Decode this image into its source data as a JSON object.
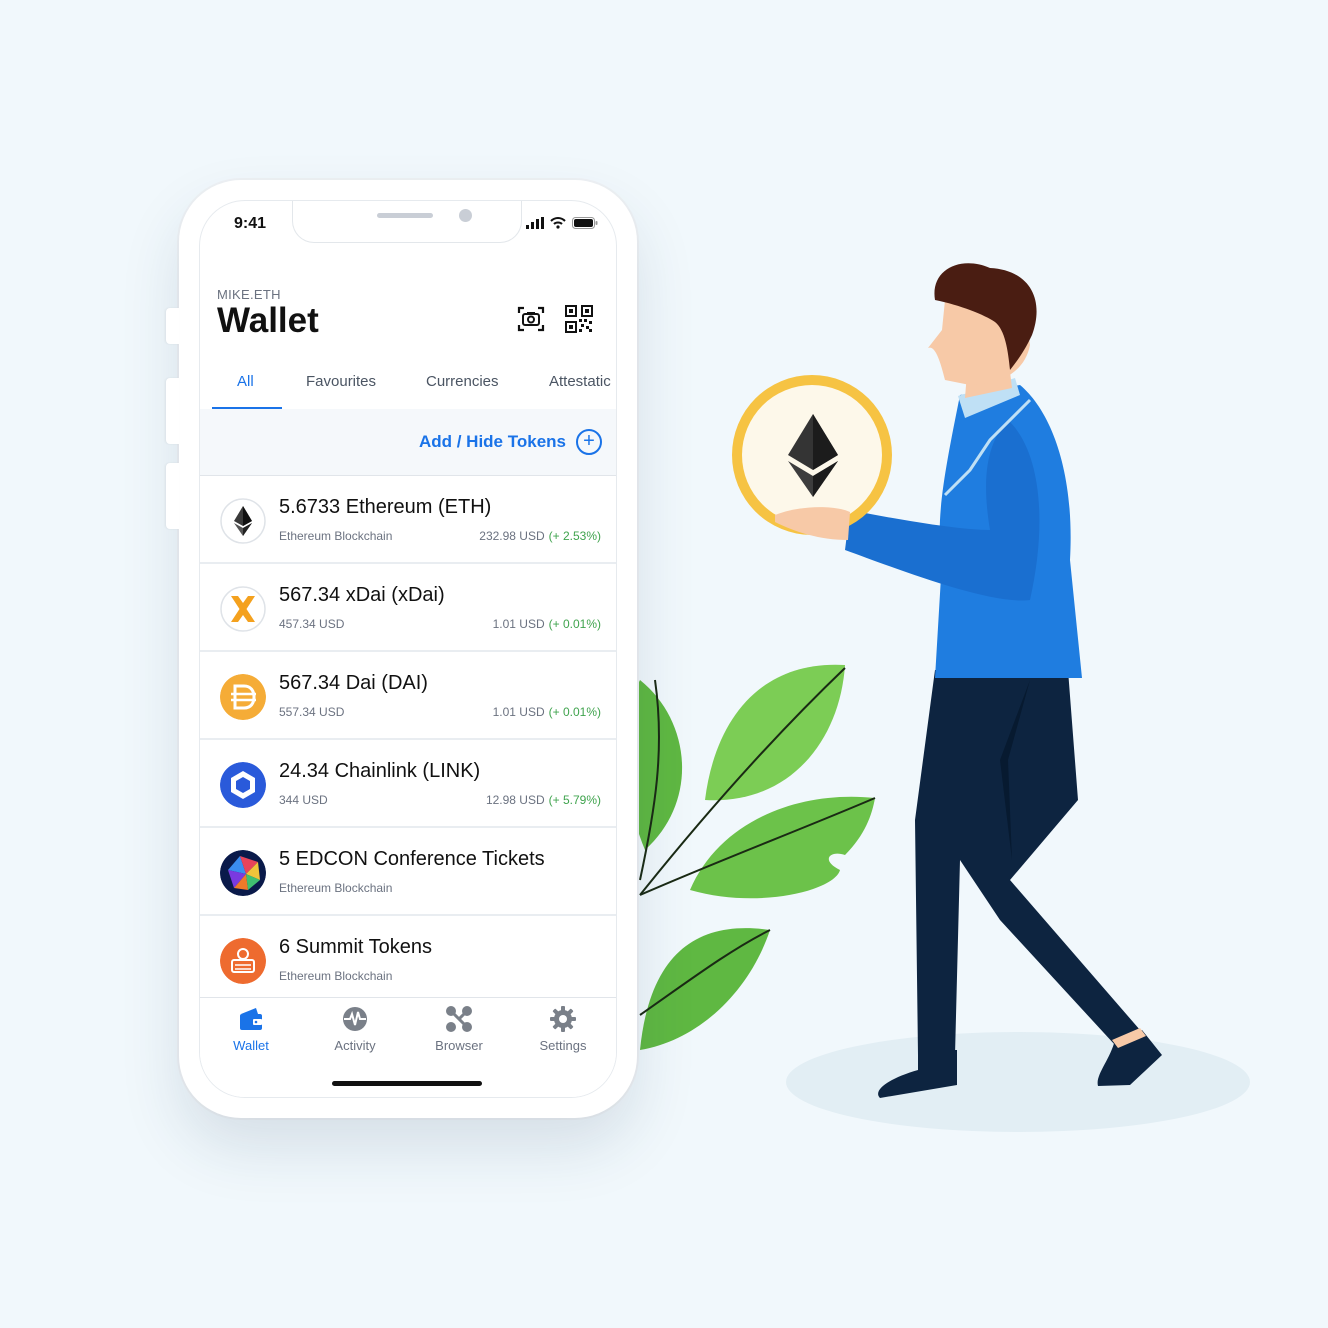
{
  "status": {
    "time": "9:41"
  },
  "header": {
    "ens_name": "MIKE.ETH",
    "title": "Wallet"
  },
  "tabs": [
    {
      "label": "All",
      "active": true
    },
    {
      "label": "Favourites",
      "active": false
    },
    {
      "label": "Currencies",
      "active": false
    },
    {
      "label": "Attestatic",
      "active": false
    }
  ],
  "add_tokens": {
    "label": "Add / Hide Tokens"
  },
  "tokens": [
    {
      "title": "5.6733 Ethereum (ETH)",
      "subtitle": "Ethereum Blockchain",
      "price": "232.98 USD",
      "change": "(+ 2.53%)",
      "icon": "ethereum-icon"
    },
    {
      "title": "567.34 xDai (xDai)",
      "subtitle": "457.34 USD",
      "price": "1.01 USD",
      "change": "(+ 0.01%)",
      "icon": "xdai-icon"
    },
    {
      "title": "567.34 Dai (DAI)",
      "subtitle": "557.34 USD",
      "price": "1.01 USD",
      "change": "(+ 0.01%)",
      "icon": "dai-icon"
    },
    {
      "title": "24.34 Chainlink (LINK)",
      "subtitle": "344 USD",
      "price": "12.98 USD",
      "change": "(+ 5.79%)",
      "icon": "chainlink-icon"
    },
    {
      "title": "5 EDCON Conference Tickets",
      "subtitle": "Ethereum Blockchain",
      "icon": "edcon-icon"
    },
    {
      "title": "6 Summit Tokens",
      "subtitle": "Ethereum Blockchain",
      "icon": "summit-icon"
    }
  ],
  "nav": [
    {
      "label": "Wallet",
      "active": true,
      "icon": "wallet-icon"
    },
    {
      "label": "Activity",
      "active": false,
      "icon": "activity-icon"
    },
    {
      "label": "Browser",
      "active": false,
      "icon": "browser-icon"
    },
    {
      "label": "Settings",
      "active": false,
      "icon": "settings-icon"
    }
  ],
  "colors": {
    "accent": "#1a73e8",
    "positive": "#3fa34d",
    "background": "#f1f8fc",
    "shirt": "#1f7de0",
    "pants": "#0d2440",
    "leaf": "#6cc24a",
    "coin": "#f6c343"
  }
}
